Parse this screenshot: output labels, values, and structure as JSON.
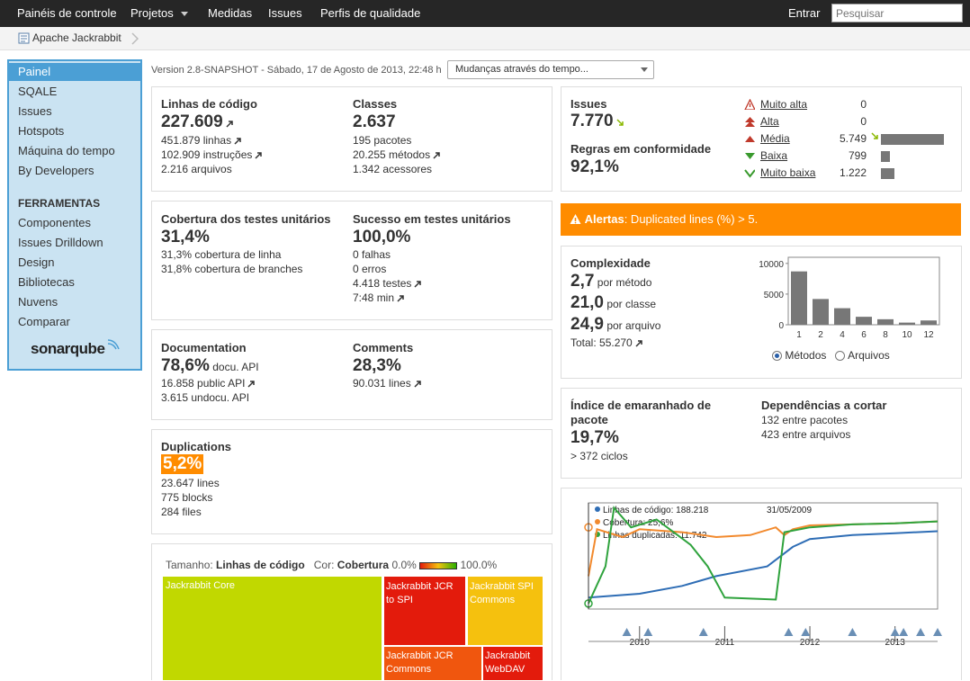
{
  "topbar": {
    "nav": [
      "Painéis de controle",
      "Projetos",
      "Medidas",
      "Issues",
      "Perfis de qualidade"
    ],
    "login": "Entrar",
    "search_placeholder": "Pesquisar"
  },
  "breadcrumb": {
    "project": "Apache Jackrabbit"
  },
  "sidebar": {
    "items": [
      "Painel",
      "SQALE",
      "Issues",
      "Hotspots",
      "Máquina do tempo",
      "By Developers"
    ],
    "tools_header": "FERRAMENTAS",
    "tools": [
      "Componentes",
      "Issues Drilldown",
      "Design",
      "Bibliotecas",
      "Nuvens",
      "Comparar"
    ],
    "logo": "sonarqube"
  },
  "version": "Version 2.8-SNAPSHOT - Sábado, 17 de Agosto de 2013, 22:48 h",
  "time_select": "Mudanças através do tempo...",
  "size": {
    "loc_label": "Linhas de código",
    "loc": "227.609",
    "lines": "451.879 linhas",
    "statements": "102.909 instruções",
    "files": "2.216 arquivos",
    "classes_label": "Classes",
    "classes": "2.637",
    "packages": "195 pacotes",
    "methods": "20.255 métodos",
    "accessors": "1.342 acessores"
  },
  "coverage": {
    "label": "Cobertura dos testes unitários",
    "value": "31,4%",
    "line": "31,3% cobertura de linha",
    "branch": "31,8% cobertura de branches",
    "success_label": "Sucesso em testes unitários",
    "success": "100,0%",
    "failures": "0 falhas",
    "errors": "0 erros",
    "tests": "4.418 testes",
    "duration": "7:48 min"
  },
  "documentation": {
    "label": "Documentation",
    "value": "78,6%",
    "unit": "docu. API",
    "public_api": "16.858 public API",
    "undoc": "3.615 undocu. API",
    "comments_label": "Comments",
    "comments": "28,3%",
    "comment_lines": "90.031 lines"
  },
  "duplications": {
    "label": "Duplications",
    "value": "5,2%",
    "lines": "23.647 lines",
    "blocks": "775 blocks",
    "files": "284 files"
  },
  "treemap": {
    "size_prefix": "Tamanho:",
    "size_metric": "Linhas de código",
    "color_prefix": "Cor:",
    "color_metric": "Cobertura",
    "min": "0.0%",
    "max": "100.0%",
    "cells": [
      {
        "name": "Jackrabbit Core",
        "color": "#c1d800"
      },
      {
        "name": "Jackrabbit JCR to SPI",
        "color": "#e31b0c"
      },
      {
        "name": "Jackrabbit SPI Commons",
        "color": "#f5c10e"
      },
      {
        "name": "Jackrabbit JCR Commons",
        "color": "#f0560e"
      },
      {
        "name": "Jackrabbit WebDAV",
        "color": "#e31b0c"
      }
    ]
  },
  "issues": {
    "label": "Issues",
    "value": "7.770",
    "compliance_label": "Regras em conformidade",
    "compliance": "92,1%",
    "severities": [
      {
        "name": "Muito alta",
        "count": "0",
        "value": 0
      },
      {
        "name": "Alta",
        "count": "0",
        "value": 0
      },
      {
        "name": "Média",
        "count": "5.749",
        "value": 5749
      },
      {
        "name": "Baixa",
        "count": "799",
        "value": 799
      },
      {
        "name": "Muito baixa",
        "count": "1.222",
        "value": 1222
      }
    ]
  },
  "alert": {
    "title": "Alertas",
    "text": ": Duplicated lines (%) > 5."
  },
  "complexity": {
    "label": "Complexidade",
    "per_method": "2,7",
    "per_method_label": "por método",
    "per_class": "21,0",
    "per_class_label": "por classe",
    "per_file": "24,9",
    "per_file_label": "por arquivo",
    "total": "Total: 55.270",
    "radio_methods": "Métodos",
    "radio_files": "Arquivos"
  },
  "tangle": {
    "label": "Índice de emaranhado de pacote",
    "value": "19,7%",
    "cycles": "> 372 ciclos",
    "deps_label": "Dependências a cortar",
    "deps_packages": "132 entre pacotes",
    "deps_files": "423 entre arquivos"
  },
  "chart_data": [
    {
      "type": "bar",
      "title": "",
      "categories": [
        "1",
        "2",
        "4",
        "6",
        "8",
        "10",
        "12"
      ],
      "values": [
        8700,
        4200,
        2700,
        1300,
        900,
        350,
        700
      ],
      "ylim": [
        0,
        11000
      ],
      "yticks": [
        "10000",
        "5000",
        "0"
      ]
    },
    {
      "type": "line",
      "date_label": "31/05/2009",
      "x_ticks": [
        "2010",
        "2011",
        "2012",
        "2013"
      ],
      "series": [
        {
          "name": "Linhas de código",
          "legend": "Linhas de código: 188.218",
          "color": "#2e6db5",
          "values": [
            [
              2009.4,
              8
            ],
            [
              2009.7,
              10
            ],
            [
              2010.0,
              12
            ],
            [
              2010.5,
              20
            ],
            [
              2010.9,
              30
            ],
            [
              2011.5,
              40
            ],
            [
              2011.8,
              60
            ],
            [
              2012.0,
              68
            ],
            [
              2012.5,
              72
            ],
            [
              2013.0,
              74
            ],
            [
              2013.5,
              76
            ]
          ]
        },
        {
          "name": "Cobertura",
          "legend": "Cobertura: 25,6%",
          "color": "#f28a2e",
          "values": [
            [
              2009.4,
              30
            ],
            [
              2009.5,
              78
            ],
            [
              2009.8,
              70
            ],
            [
              2010.0,
              78
            ],
            [
              2010.5,
              75
            ],
            [
              2010.9,
              70
            ],
            [
              2011.3,
              72
            ],
            [
              2011.6,
              80
            ],
            [
              2011.7,
              72
            ],
            [
              2011.8,
              78
            ],
            [
              2012.0,
              82
            ],
            [
              2012.5,
              83
            ],
            [
              2013.0,
              84
            ],
            [
              2013.5,
              86
            ]
          ]
        },
        {
          "name": "Linhas duplicadas",
          "legend": "Linhas duplicadas: 11.742",
          "color": "#2fa33d",
          "values": [
            [
              2009.4,
              2
            ],
            [
              2009.6,
              40
            ],
            [
              2009.7,
              100
            ],
            [
              2009.9,
              80
            ],
            [
              2010.2,
              88
            ],
            [
              2010.6,
              62
            ],
            [
              2010.8,
              40
            ],
            [
              2011.0,
              8
            ],
            [
              2011.6,
              6
            ],
            [
              2011.7,
              75
            ],
            [
              2012.0,
              80
            ],
            [
              2012.5,
              83
            ],
            [
              2013.0,
              84
            ],
            [
              2013.5,
              86
            ]
          ]
        }
      ]
    }
  ]
}
